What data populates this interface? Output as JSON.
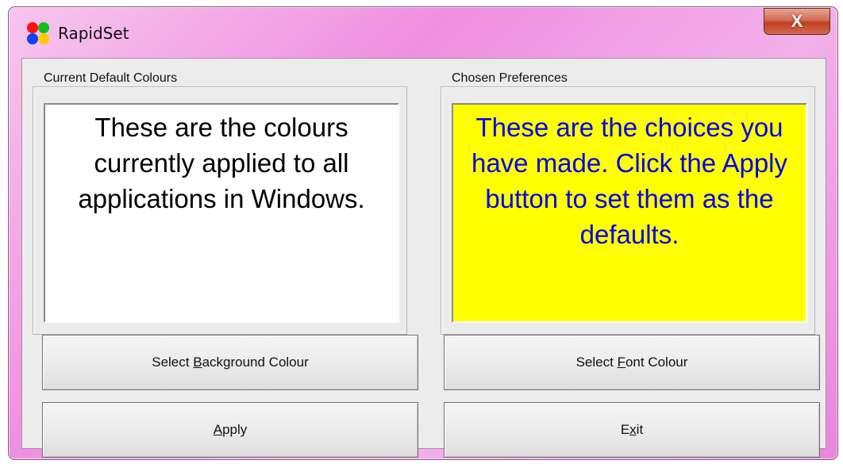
{
  "window": {
    "title": "RapidSet",
    "close_label": "X"
  },
  "current_defaults": {
    "label": "Current Default Colours",
    "text": "These are the colours currently applied to all applications in Windows.",
    "background_color": "#ffffff",
    "font_color": "#000000"
  },
  "chosen_preferences": {
    "label": "Chosen Preferences",
    "text": "These are the choices you have made.  Click the Apply button to set them as the defaults.",
    "background_color": "#ffff00",
    "font_color": "#0000ee"
  },
  "buttons": {
    "background": {
      "pre": "Select ",
      "key": "B",
      "post": "ackground Colour"
    },
    "font": {
      "pre": "Select ",
      "key": "F",
      "post": "ont Colour"
    },
    "apply": {
      "pre": "",
      "key": "A",
      "post": "pply"
    },
    "exit": {
      "pre": "E",
      "key": "x",
      "post": "it"
    }
  },
  "icon": {
    "name": "rapidset-app-icon",
    "colors": [
      "#ff0000",
      "#00cc00",
      "#0044ff",
      "#ffcc00"
    ]
  }
}
